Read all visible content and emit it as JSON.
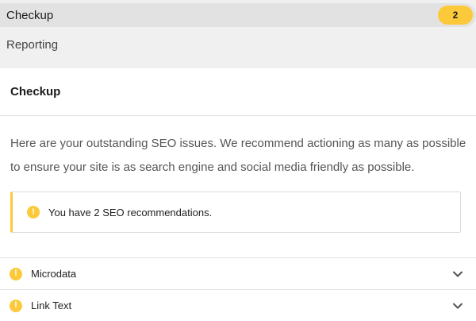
{
  "nav": {
    "checkup_label": "Checkup",
    "checkup_badge": "2",
    "reporting_label": "Reporting"
  },
  "card": {
    "title": "Checkup",
    "intro": "Here are your outstanding SEO issues. We recommend actioning as many as possible to ensure your site is as search engine and social media friendly as possible."
  },
  "notice": {
    "icon": "warning-icon",
    "text": "You have 2 SEO recommendations."
  },
  "issues": [
    {
      "label": "Microdata",
      "icon": "warning-icon",
      "expand_icon": "chevron-down-icon"
    },
    {
      "label": "Link Text",
      "icon": "warning-icon",
      "expand_icon": "chevron-down-icon"
    }
  ],
  "colors": {
    "accent": "#fcc93a",
    "nav_background": "#f0f0f0",
    "active_item": "#e2e2e2",
    "divider": "#e2e2e2",
    "body_text": "#555555"
  }
}
